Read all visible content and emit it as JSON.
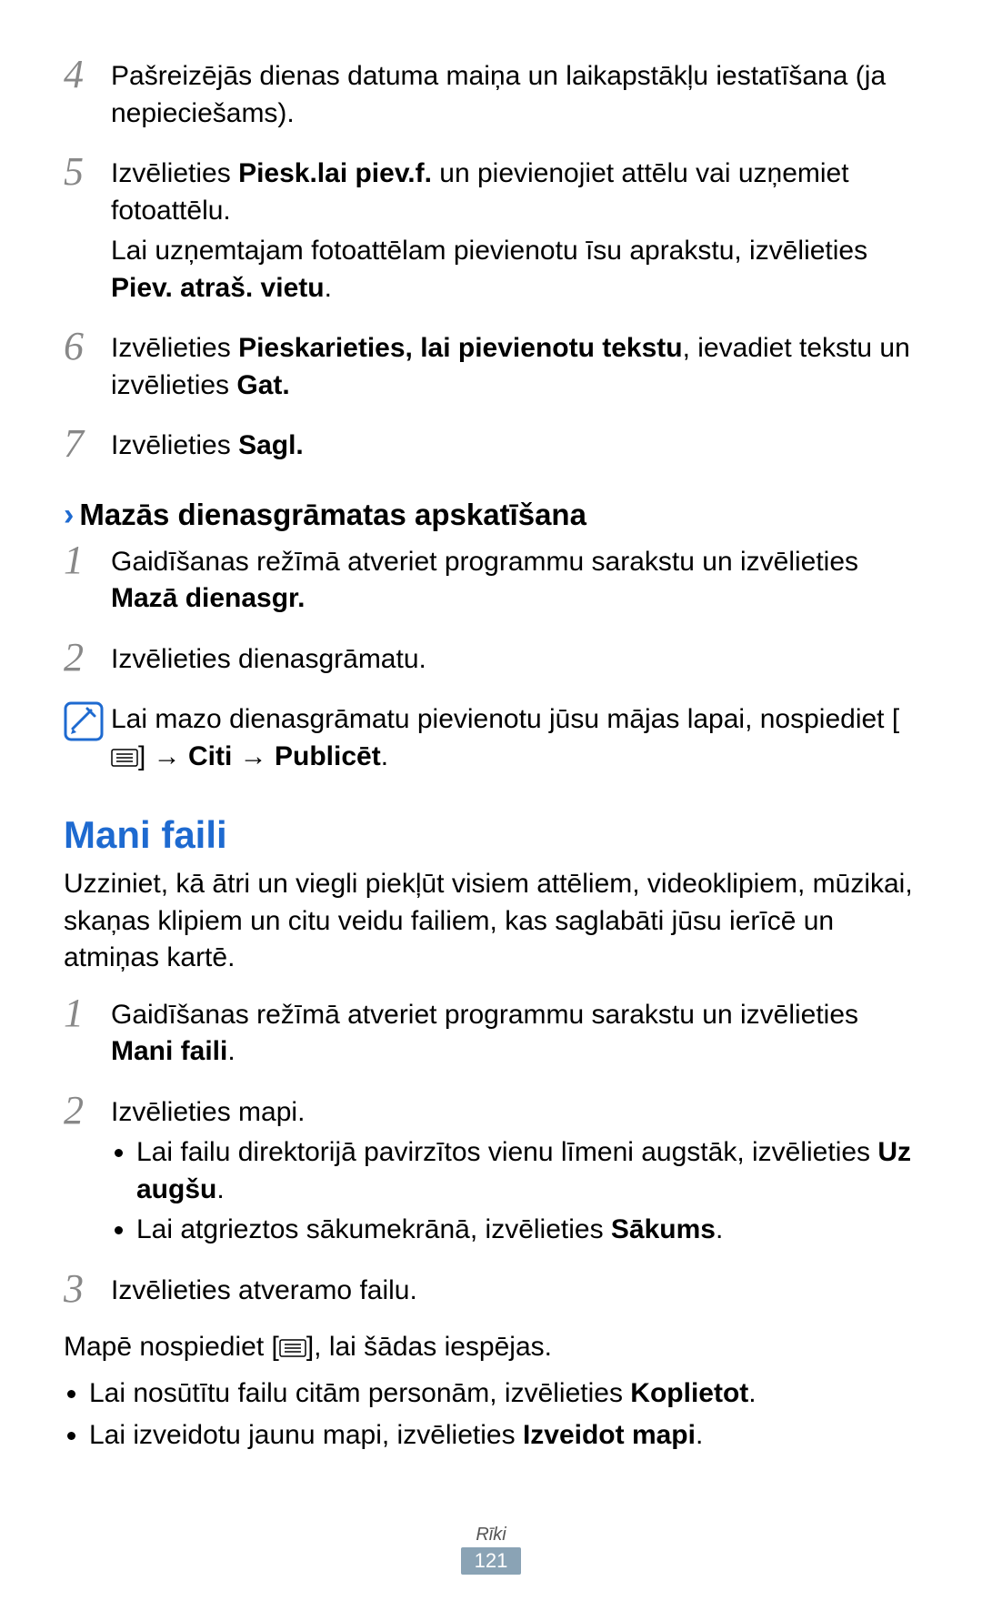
{
  "steps_top": {
    "s4": {
      "num": "4",
      "p1": "Pašreizējās dienas datuma maiņa un laikapstākļu iestatīšana (ja nepieciešams)."
    },
    "s5": {
      "num": "5",
      "p1_pre": "Izvēlieties ",
      "p1_b1": "Piesk.lai piev.f.",
      "p1_post": " un pievienojiet attēlu vai uzņemiet fotoattēlu.",
      "p2_pre": "Lai uzņemtajam fotoattēlam pievienotu īsu aprakstu, izvēlieties ",
      "p2_b": "Piev. atraš. vietu",
      "p2_post": "."
    },
    "s6": {
      "num": "6",
      "p1_pre": "Izvēlieties ",
      "p1_b1": "Pieskarieties, lai pievienotu tekstu",
      "p1_mid": ", ievadiet tekstu un izvēlieties ",
      "p1_b2": "Gat.",
      "p1_post": ""
    },
    "s7": {
      "num": "7",
      "p1_pre": "Izvēlieties ",
      "p1_b": "Sagl.",
      "p1_post": ""
    }
  },
  "subheading1": "Mazās dienasgrāmatas apskatīšana",
  "diary_steps": {
    "s1": {
      "num": "1",
      "p1_pre": "Gaidīšanas režīmā atveriet programmu sarakstu un izvēlieties ",
      "p1_b": "Mazā dienasgr.",
      "p1_post": ""
    },
    "s2": {
      "num": "2",
      "p1": "Izvēlieties dienasgrāmatu."
    }
  },
  "note1": {
    "pre": "Lai mazo dienasgrāmatu pievienotu jūsu mājas lapai, nospiediet [",
    "mid1": "] → ",
    "b1": "Citi",
    "mid2": " → ",
    "b2": "Publicēt",
    "post": "."
  },
  "section_title": "Mani faili",
  "intro": "Uzziniet, kā ātri un viegli piekļūt visiem attēliem, videoklipiem, mūzikai, skaņas klipiem un citu veidu failiem, kas saglabāti jūsu ierīcē un atmiņas kartē.",
  "files_steps": {
    "s1": {
      "num": "1",
      "p1_pre": "Gaidīšanas režīmā atveriet programmu sarakstu un izvēlieties ",
      "p1_b": "Mani faili",
      "p1_post": "."
    },
    "s2": {
      "num": "2",
      "p1": "Izvēlieties mapi.",
      "b1_pre": "Lai failu direktorijā pavirzītos vienu līmeni augstāk, izvēlieties ",
      "b1_b": "Uz augšu",
      "b1_post": ".",
      "b2_pre": "Lai atgrieztos sākumekrānā, izvēlieties ",
      "b2_b": "Sākums",
      "b2_post": "."
    },
    "s3": {
      "num": "3",
      "p1": "Izvēlieties atveramo failu."
    }
  },
  "folder_para": {
    "pre": "Mapē nospiediet [",
    "post": "], lai šādas iespējas."
  },
  "folder_bullets": {
    "b1_pre": "Lai nosūtītu failu citām personām, izvēlieties ",
    "b1_b": "Koplietot",
    "b1_post": ".",
    "b2_pre": "Lai izveidotu jaunu mapi, izvēlieties ",
    "b2_b": "Izveidot mapi",
    "b2_post": "."
  },
  "footer": {
    "category": "Rīki",
    "page": "121"
  }
}
